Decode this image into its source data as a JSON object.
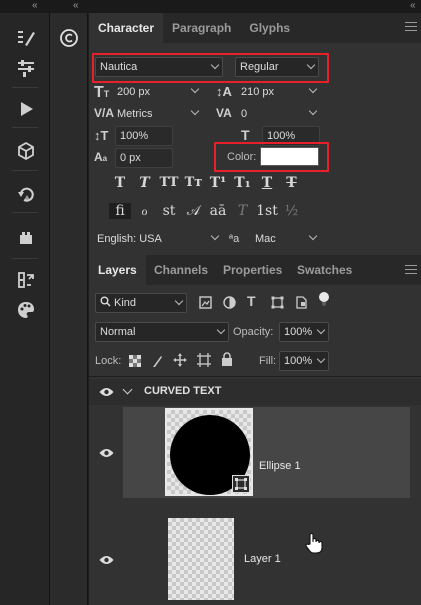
{
  "collapse_glyph": "«",
  "character_panel": {
    "tabs": [
      "Character",
      "Paragraph",
      "Glyphs"
    ],
    "font_family": "Nautica",
    "font_style": "Regular",
    "font_size": "200 px",
    "leading": "210 px",
    "kerning": "Metrics",
    "tracking": "0",
    "vertical_scale": "100%",
    "horizontal_scale": "100%",
    "baseline_shift": "0 px",
    "color_label": "Color:",
    "color_value": "#ffffff",
    "type_style_glyphs": [
      "T",
      "T",
      "TT",
      "Tт",
      "T¹",
      "T₁",
      "T",
      "T"
    ],
    "opentype_glyphs": [
      "fi",
      "ℴ",
      "st",
      "𝒜",
      "aā",
      "T",
      "1st",
      "½"
    ],
    "language": "English: USA",
    "antialias_icon_label": "ªa",
    "antialias": "Mac"
  },
  "layers_panel": {
    "tabs": [
      "Layers",
      "Channels",
      "Properties",
      "Swatches"
    ],
    "filter_kind": "Kind",
    "blend_mode": "Normal",
    "opacity_label": "Opacity:",
    "opacity": "100%",
    "lock_label": "Lock:",
    "fill_label": "Fill:",
    "fill": "100%",
    "group_name": "CURVED TEXT",
    "layers": [
      {
        "name": "Ellipse 1"
      },
      {
        "name": "Layer 1"
      }
    ]
  }
}
